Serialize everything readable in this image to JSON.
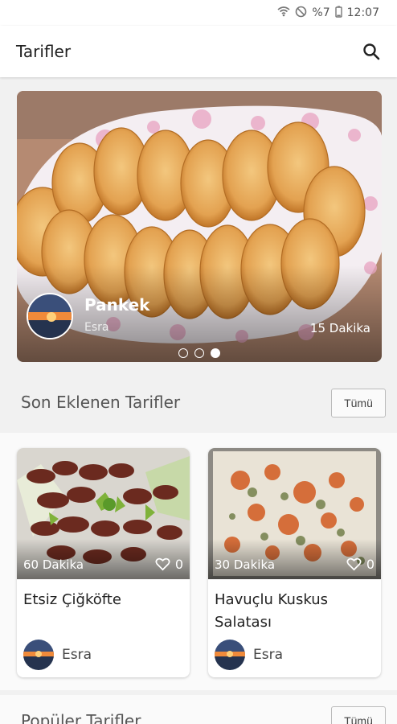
{
  "status_bar": {
    "battery": "%7",
    "time": "12:07",
    "icons": [
      "wifi-icon",
      "dnd-icon",
      "battery-icon"
    ]
  },
  "app_bar": {
    "title": "Tarifler",
    "search_icon": "search-icon"
  },
  "featured": {
    "title": "Pankek",
    "author": "Esra",
    "duration": "15 Dakika",
    "pages": 3,
    "active_page": 3
  },
  "recent_section": {
    "title": "Son Eklenen Tarifler",
    "all_label": "Tümü",
    "recipes": [
      {
        "name": "Etsiz Çiğköfte",
        "duration": "60 Dakika",
        "likes": "0",
        "author": "Esra"
      },
      {
        "name": "Havuçlu Kuskus Salatası",
        "duration": "30 Dakika",
        "likes": "0",
        "author": "Esra"
      }
    ]
  },
  "next_section": {
    "title": "Popüler Tarifler",
    "all_label": "Tümü"
  },
  "colors": {
    "accent": "#e8a245",
    "background": "#f1f1f1"
  }
}
